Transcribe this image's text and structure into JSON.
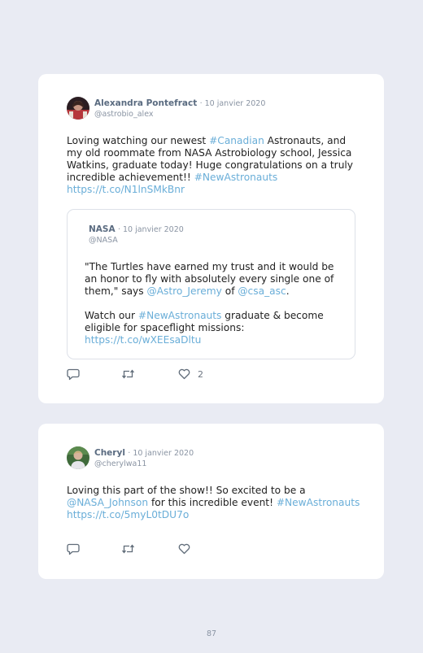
{
  "tweets": [
    {
      "author": "Alexandra Pontefract",
      "date": "· 10 janvier 2020",
      "handle": "@astrobio_alex",
      "text": {
        "p1": "Loving watching our newest ",
        "tag_canadian": "#Canadian",
        "p2": " Astronauts, and my old roommate from NASA Astrobiology school, Jessica Watkins, graduate today! Huge congratulations on a truly incredible achievement!! ",
        "tag_new": "#NewAstronauts",
        "url": "https://t.co/N1lnSMkBnr"
      },
      "quote": {
        "author": "NASA",
        "date": "· 10 janvier 2020",
        "handle": "@NASA",
        "text": {
          "p1": "\"The Turtles have earned my trust and it would be an honor to fly with absolutely every single one of them,\" says ",
          "mention1": "@Astro_Jeremy",
          "p2": " of ",
          "mention2": "@csa_asc",
          "p3": ".",
          "p4": "Watch our ",
          "tag": "#NewAstronauts",
          "p5": " graduate & become eligible for spaceflight missions:",
          "url": "https://t.co/wXEEsaDltu"
        }
      },
      "likes": "2"
    },
    {
      "author": "Cheryl",
      "date": "· 10 janvier 2020",
      "handle": "@cherylwa11",
      "text": {
        "p1": "Loving this part of the show!! So excited to be a ",
        "mention": "@NASA_Johnson",
        "p2": " for this incredible event! ",
        "tag": "#NewAstronauts",
        "url": "https://t.co/5myL0tDU7o"
      }
    }
  ],
  "page_number": "87",
  "icons": [
    "reply-icon",
    "retweet-icon",
    "like-icon"
  ],
  "colors": {
    "link": "#6aaed8",
    "name": "#5a6b80",
    "meta": "#8a94a3",
    "background": "#e9ebf3"
  }
}
